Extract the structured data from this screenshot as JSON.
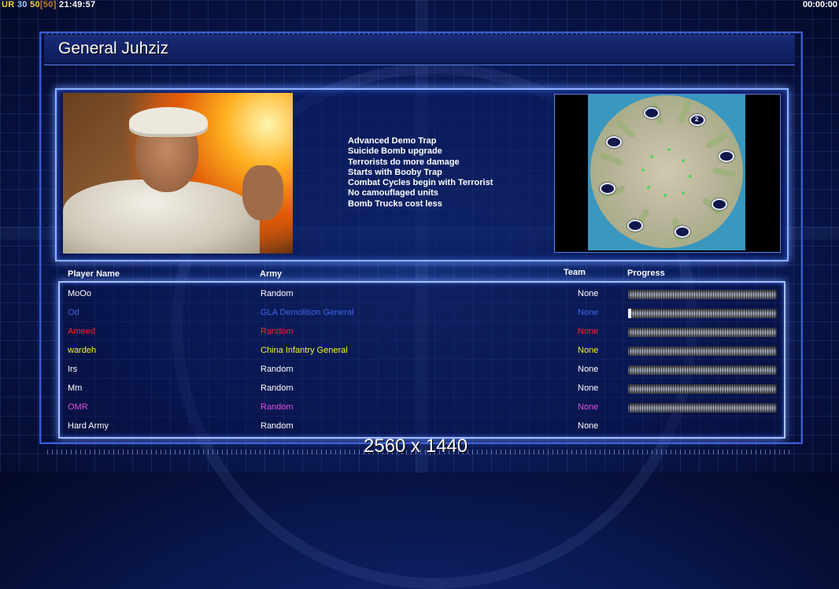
{
  "hud": {
    "ur_label": "UR",
    "ur_value1": "30",
    "ur_value2": "50",
    "ur_value3": "[50]",
    "clock": "21:49:57",
    "timer": "00:00:00"
  },
  "title": "General Juhziz",
  "bonuses": [
    "Advanced Demo Trap",
    "Suicide Bomb upgrade",
    "Terrorists do more damage",
    "Starts with Booby Trap",
    "Combat Cycles begin with Terrorist",
    "No camouflaged units",
    "Bomb Trucks cost less"
  ],
  "map": {
    "start_label": "2"
  },
  "columns": {
    "player_name": "Player Name",
    "army": "Army",
    "team": "Team",
    "progress": "Progress"
  },
  "players": [
    {
      "name": "MoOo",
      "army": "Random",
      "team": "None",
      "color": "#ffffff",
      "progress": 0,
      "show_bar": true
    },
    {
      "name": "Od",
      "army": "GLA Demolition General",
      "team": "None",
      "color": "#3e63e0",
      "progress": 0.02,
      "show_bar": true
    },
    {
      "name": "Ameed",
      "army": "Random",
      "team": "None",
      "color": "#ff2020",
      "progress": 0,
      "show_bar": true
    },
    {
      "name": "wardeh",
      "army": "China Infantry General",
      "team": "None",
      "color": "#f2f22a",
      "progress": 0,
      "show_bar": true
    },
    {
      "name": "Irs",
      "army": "Random",
      "team": "None",
      "color": "#ffffff",
      "progress": 0,
      "show_bar": true
    },
    {
      "name": "Mm",
      "army": "Random",
      "team": "None",
      "color": "#ffffff",
      "progress": 0,
      "show_bar": true
    },
    {
      "name": "OMR",
      "army": "Random",
      "team": "None",
      "color": "#e24fe2",
      "progress": 0,
      "show_bar": true
    },
    {
      "name": "Hard Army",
      "army": "Random",
      "team": "None",
      "color": "#ffffff",
      "progress": 0,
      "show_bar": false
    }
  ],
  "resolution": "2560 x 1440"
}
